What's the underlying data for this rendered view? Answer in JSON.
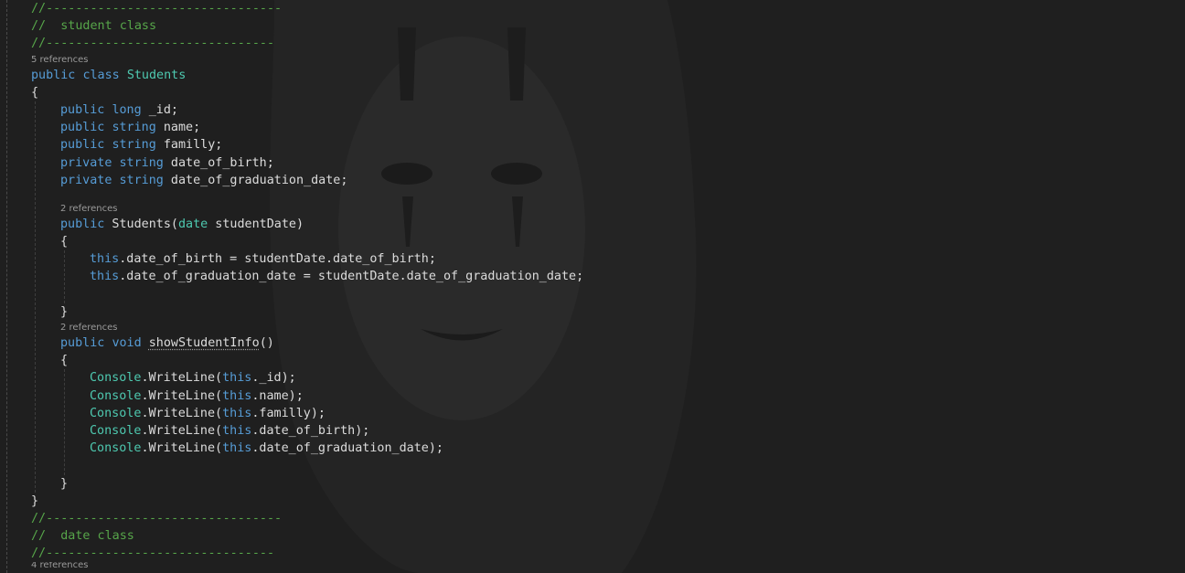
{
  "editor": {
    "colors": {
      "background": "#1f1f1f",
      "comment": "#57a64a",
      "keyword": "#569cd6",
      "type": "#4ec9b0",
      "identifier": "#dcdcdc",
      "codelens": "#9a9a9a"
    },
    "background_art": "faceless-mask-watermark",
    "lines": [
      {
        "kind": "code",
        "indent": 0,
        "tokens": [
          {
            "c": "cm",
            "t": "//--------------------------------"
          }
        ]
      },
      {
        "kind": "code",
        "indent": 0,
        "tokens": [
          {
            "c": "cm",
            "t": "//  student class"
          }
        ]
      },
      {
        "kind": "code",
        "indent": 0,
        "tokens": [
          {
            "c": "cm",
            "t": "//-------------------------------"
          }
        ]
      },
      {
        "kind": "lens",
        "indent": 0,
        "text": "5 references"
      },
      {
        "kind": "code",
        "indent": 0,
        "tokens": [
          {
            "c": "kw",
            "t": "public"
          },
          {
            "c": "tx",
            "t": " "
          },
          {
            "c": "kw",
            "t": "class"
          },
          {
            "c": "tx",
            "t": " "
          },
          {
            "c": "ty",
            "t": "Students"
          }
        ]
      },
      {
        "kind": "code",
        "indent": 0,
        "tokens": [
          {
            "c": "tx",
            "t": "{"
          }
        ]
      },
      {
        "kind": "code",
        "indent": 1,
        "tokens": [
          {
            "c": "kw",
            "t": "public"
          },
          {
            "c": "tx",
            "t": " "
          },
          {
            "c": "kw",
            "t": "long"
          },
          {
            "c": "tx",
            "t": " _id;"
          }
        ]
      },
      {
        "kind": "code",
        "indent": 1,
        "tokens": [
          {
            "c": "kw",
            "t": "public"
          },
          {
            "c": "tx",
            "t": " "
          },
          {
            "c": "kw",
            "t": "string"
          },
          {
            "c": "tx",
            "t": " name;"
          }
        ]
      },
      {
        "kind": "code",
        "indent": 1,
        "tokens": [
          {
            "c": "kw",
            "t": "public"
          },
          {
            "c": "tx",
            "t": " "
          },
          {
            "c": "kw",
            "t": "string"
          },
          {
            "c": "tx",
            "t": " familly;"
          }
        ]
      },
      {
        "kind": "code",
        "indent": 1,
        "tokens": [
          {
            "c": "kw",
            "t": "private"
          },
          {
            "c": "tx",
            "t": " "
          },
          {
            "c": "kw",
            "t": "string"
          },
          {
            "c": "tx",
            "t": " date_of_birth;"
          }
        ]
      },
      {
        "kind": "code",
        "indent": 1,
        "tokens": [
          {
            "c": "kw",
            "t": "private"
          },
          {
            "c": "tx",
            "t": " "
          },
          {
            "c": "kw",
            "t": "string"
          },
          {
            "c": "tx",
            "t": " date_of_graduation_date;"
          }
        ]
      },
      {
        "kind": "blank"
      },
      {
        "kind": "lens",
        "indent": 1,
        "text": "2 references"
      },
      {
        "kind": "code",
        "indent": 1,
        "tokens": [
          {
            "c": "kw",
            "t": "public"
          },
          {
            "c": "tx",
            "t": " Students("
          },
          {
            "c": "ty",
            "t": "date"
          },
          {
            "c": "tx",
            "t": " studentDate)"
          }
        ]
      },
      {
        "kind": "code",
        "indent": 1,
        "tokens": [
          {
            "c": "tx",
            "t": "{"
          }
        ]
      },
      {
        "kind": "code",
        "indent": 2,
        "tokens": [
          {
            "c": "kw",
            "t": "this"
          },
          {
            "c": "tx",
            "t": ".date_of_birth = studentDate.date_of_birth;"
          }
        ]
      },
      {
        "kind": "code",
        "indent": 2,
        "tokens": [
          {
            "c": "kw",
            "t": "this"
          },
          {
            "c": "tx",
            "t": ".date_of_graduation_date = studentDate.date_of_graduation_date;"
          }
        ]
      },
      {
        "kind": "code",
        "indent": 0,
        "tokens": [
          {
            "c": "tx",
            "t": ""
          }
        ]
      },
      {
        "kind": "code",
        "indent": 1,
        "tokens": [
          {
            "c": "tx",
            "t": "}"
          }
        ]
      },
      {
        "kind": "lens",
        "indent": 1,
        "text": "2 references"
      },
      {
        "kind": "code",
        "indent": 1,
        "tokens": [
          {
            "c": "kw",
            "t": "public"
          },
          {
            "c": "tx",
            "t": " "
          },
          {
            "c": "kw",
            "t": "void"
          },
          {
            "c": "tx",
            "t": " "
          },
          {
            "c": "tx squig",
            "t": "showStudentInfo"
          },
          {
            "c": "tx",
            "t": "()"
          }
        ]
      },
      {
        "kind": "code",
        "indent": 1,
        "tokens": [
          {
            "c": "tx",
            "t": "{"
          }
        ]
      },
      {
        "kind": "code",
        "indent": 2,
        "tokens": [
          {
            "c": "ty",
            "t": "Console"
          },
          {
            "c": "tx",
            "t": ".WriteLine("
          },
          {
            "c": "kw",
            "t": "this"
          },
          {
            "c": "tx",
            "t": "._id);"
          }
        ]
      },
      {
        "kind": "code",
        "indent": 2,
        "tokens": [
          {
            "c": "ty",
            "t": "Console"
          },
          {
            "c": "tx",
            "t": ".WriteLine("
          },
          {
            "c": "kw",
            "t": "this"
          },
          {
            "c": "tx",
            "t": ".name);"
          }
        ]
      },
      {
        "kind": "code",
        "indent": 2,
        "tokens": [
          {
            "c": "ty",
            "t": "Console"
          },
          {
            "c": "tx",
            "t": ".WriteLine("
          },
          {
            "c": "kw",
            "t": "this"
          },
          {
            "c": "tx",
            "t": ".familly);"
          }
        ]
      },
      {
        "kind": "code",
        "indent": 2,
        "tokens": [
          {
            "c": "ty",
            "t": "Console"
          },
          {
            "c": "tx",
            "t": ".WriteLine("
          },
          {
            "c": "kw",
            "t": "this"
          },
          {
            "c": "tx",
            "t": ".date_of_birth);"
          }
        ]
      },
      {
        "kind": "code",
        "indent": 2,
        "tokens": [
          {
            "c": "ty",
            "t": "Console"
          },
          {
            "c": "tx",
            "t": ".WriteLine("
          },
          {
            "c": "kw",
            "t": "this"
          },
          {
            "c": "tx",
            "t": ".date_of_graduation_date);"
          }
        ]
      },
      {
        "kind": "code",
        "indent": 0,
        "tokens": [
          {
            "c": "tx",
            "t": ""
          }
        ]
      },
      {
        "kind": "code",
        "indent": 1,
        "tokens": [
          {
            "c": "tx",
            "t": "}"
          }
        ]
      },
      {
        "kind": "code",
        "indent": 0,
        "tokens": [
          {
            "c": "tx",
            "t": "}"
          }
        ]
      },
      {
        "kind": "code",
        "indent": 0,
        "tokens": [
          {
            "c": "cm",
            "t": "//--------------------------------"
          }
        ]
      },
      {
        "kind": "code",
        "indent": 0,
        "tokens": [
          {
            "c": "cm",
            "t": "//  date class"
          }
        ]
      },
      {
        "kind": "code",
        "indent": 0,
        "tokens": [
          {
            "c": "cm",
            "t": "//-------------------------------"
          }
        ]
      },
      {
        "kind": "lens-partial",
        "indent": 0,
        "text": "4 references"
      }
    ]
  }
}
